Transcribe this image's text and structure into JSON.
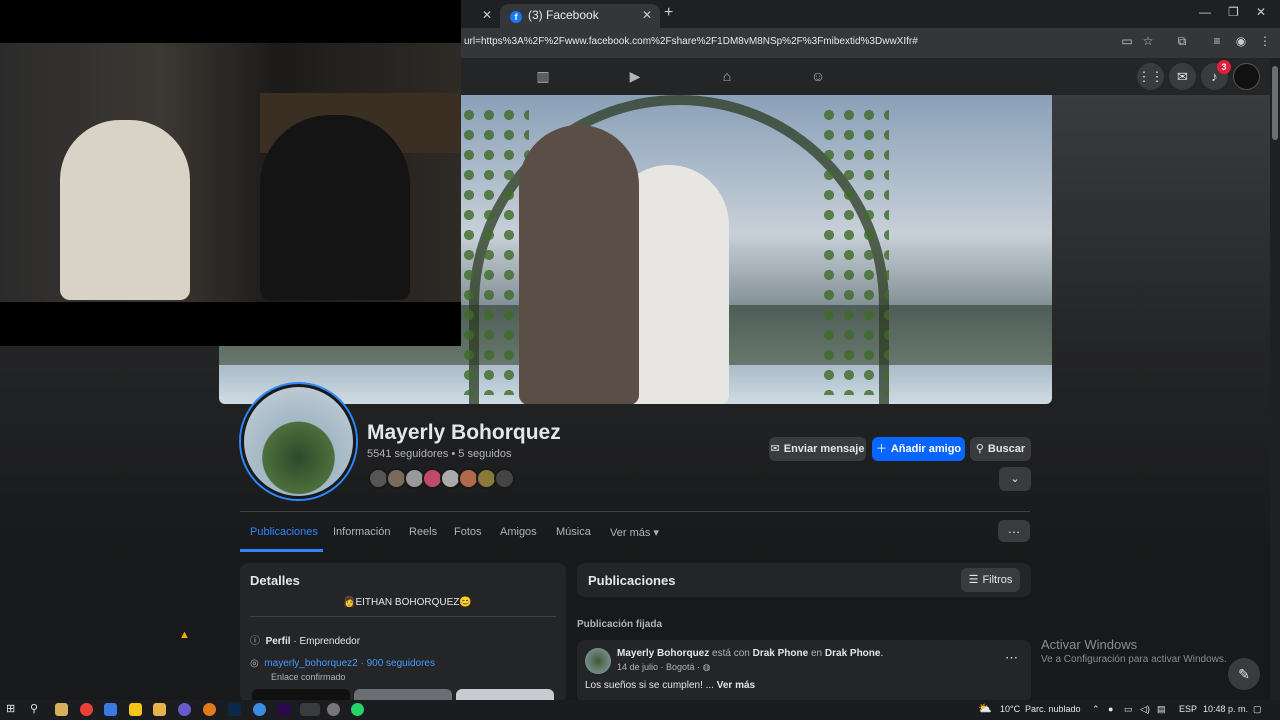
{
  "browser": {
    "tabs": [
      {
        "label": ""
      },
      {
        "label": "(3) Facebook"
      }
    ],
    "url": "url=https%3A%2F%2Fwww.facebook.com%2Fshare%2F1DM8vM8NSp%2F%3Fmibextid%3DwwXIfr#"
  },
  "fb_nav": {
    "notifications_count": "3"
  },
  "profile": {
    "name": "Mayerly Bohorquez",
    "stats": "5541 seguidores • 5 seguidos",
    "buttons": {
      "message": "Enviar mensaje",
      "add_friend": "Añadir amigo",
      "search": "Buscar"
    },
    "tabs": [
      "Publicaciones",
      "Información",
      "Reels",
      "Fotos",
      "Amigos",
      "Música",
      "Ver más"
    ],
    "active_tab": "Publicaciones"
  },
  "details": {
    "title": "Detalles",
    "bio": "EITHAN BOHORQUEZ",
    "profile_label": "Perfil",
    "profile_value": "· Emprendedor",
    "instagram_handle": "mayerly_bohorquez2",
    "instagram_followers": "· 900 seguidores",
    "instagram_status": "Enlace confirmado"
  },
  "posts": {
    "title": "Publicaciones",
    "filters_label": "Filtros",
    "pinned_label": "Publicación fijada",
    "post": {
      "author": "Mayerly Bohorquez",
      "with_text": "está con",
      "with_name": "Drak Phone",
      "in_text": "en",
      "place": "Drak Phone",
      "meta": "14 de julio · Bogotá ·",
      "text": "Los sueños si se cumplen! ...",
      "see_more": "Ver más"
    }
  },
  "watermark": {
    "line1": "Activar Windows",
    "line2": "Ve a Configuración para activar Windows."
  },
  "taskbar": {
    "weather": "10°C",
    "weather_desc": "Parc. nublado",
    "lang": "ESP",
    "time": "10:48 p. m."
  }
}
